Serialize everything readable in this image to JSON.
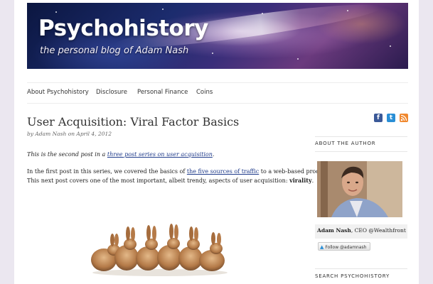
{
  "header": {
    "site_title": "Psychohistory",
    "tagline": "the personal blog of Adam Nash"
  },
  "nav": {
    "items": [
      {
        "label": "About Psychohistory"
      },
      {
        "label": "Disclosure"
      },
      {
        "label": "Personal Finance"
      },
      {
        "label": "Coins"
      }
    ]
  },
  "post": {
    "title": "User Acquisition: Viral Factor Basics",
    "meta": "by Adam Nash on April 4, 2012",
    "intro_before": "This is the second post in a ",
    "intro_link": "three post series on user acquisition",
    "intro_after": ".",
    "body_before": "In the first post in this series, we covered the basics of ",
    "body_link": "the five sources of traffic",
    "body_after": " to a web-based product.",
    "body_line2": " This next post covers one of the most important, albeit trendy, aspects of user acquisition: ",
    "body_bold": "virality",
    "body_end": "."
  },
  "social": {
    "facebook_icon": "facebook-icon",
    "twitter_icon": "twitter-icon",
    "rss_icon": "rss-icon",
    "facebook_color": "#3b5998",
    "twitter_color": "#2a8fd6",
    "rss_color": "#f0882e"
  },
  "sidebar": {
    "about_heading": "ABOUT THE AUTHOR",
    "author_name": "Adam Nash",
    "author_role": ", CEO @Wealthfront",
    "follow_label": "Follow @adamnash",
    "search_heading": "SEARCH PSYCHOHISTORY"
  }
}
